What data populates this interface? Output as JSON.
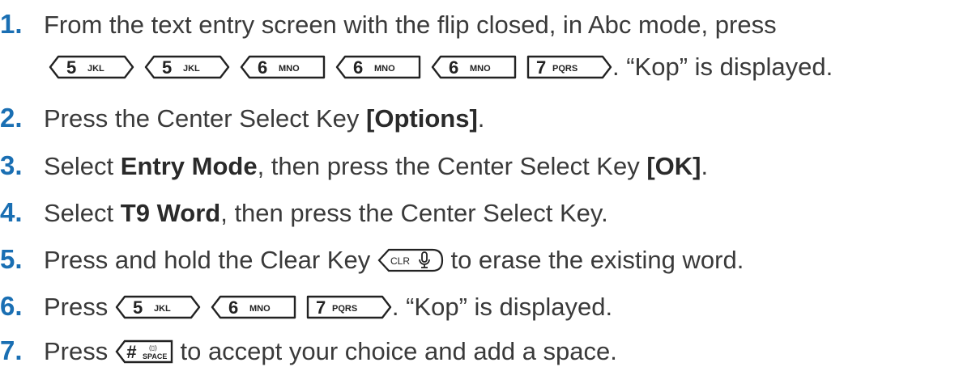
{
  "steps": [
    {
      "number": "1.",
      "text_a": "From the text entry screen with the flip closed, in Abc mode, press",
      "keys": [
        {
          "icon": "key-5-jkl-icon",
          "digit": "5",
          "letters": "JKL",
          "shape": "round"
        },
        {
          "icon": "key-5-jkl-icon",
          "digit": "5",
          "letters": "JKL",
          "shape": "round"
        },
        {
          "icon": "key-6-mno-icon",
          "digit": "6",
          "letters": "MNO",
          "shape": "left"
        },
        {
          "icon": "key-6-mno-icon",
          "digit": "6",
          "letters": "MNO",
          "shape": "left"
        },
        {
          "icon": "key-6-mno-icon",
          "digit": "6",
          "letters": "MNO",
          "shape": "left"
        },
        {
          "icon": "key-7-pqrs-icon",
          "digit": "7",
          "letters": "PQRS",
          "shape": "right"
        }
      ],
      "text_b": ". “Kop” is displayed."
    },
    {
      "number": "2.",
      "pre": "Press the Center Select Key ",
      "bold": "[Options]",
      "post": "."
    },
    {
      "number": "3.",
      "pre": "Select ",
      "bold": "Entry Mode",
      "mid": ", then press the Center Select Key ",
      "bold2": "[OK]",
      "post": "."
    },
    {
      "number": "4.",
      "pre": "Select ",
      "bold": "T9 Word",
      "post": ", then press the Center Select Key."
    },
    {
      "number": "5.",
      "pre": "Press and hold the Clear Key ",
      "key": {
        "icon": "clear-key-icon",
        "label": "CLR"
      },
      "post": " to erase the existing word."
    },
    {
      "number": "6.",
      "pre": "Press ",
      "keys": [
        {
          "icon": "key-5-jkl-icon",
          "digit": "5",
          "letters": "JKL",
          "shape": "round"
        },
        {
          "icon": "key-6-mno-icon",
          "digit": "6",
          "letters": "MNO",
          "shape": "left"
        },
        {
          "icon": "key-7-pqrs-icon",
          "digit": "7",
          "letters": "PQRS",
          "shape": "right"
        }
      ],
      "post": ". “Kop” is displayed."
    },
    {
      "number": "7.",
      "pre": "Press ",
      "key": {
        "icon": "pound-space-key-icon",
        "digit": "#",
        "letters": "SPACE"
      },
      "post": " to accept your choice and add a space."
    }
  ],
  "colors": {
    "number": "#1a6fb3",
    "text": "#3a3a3a"
  }
}
